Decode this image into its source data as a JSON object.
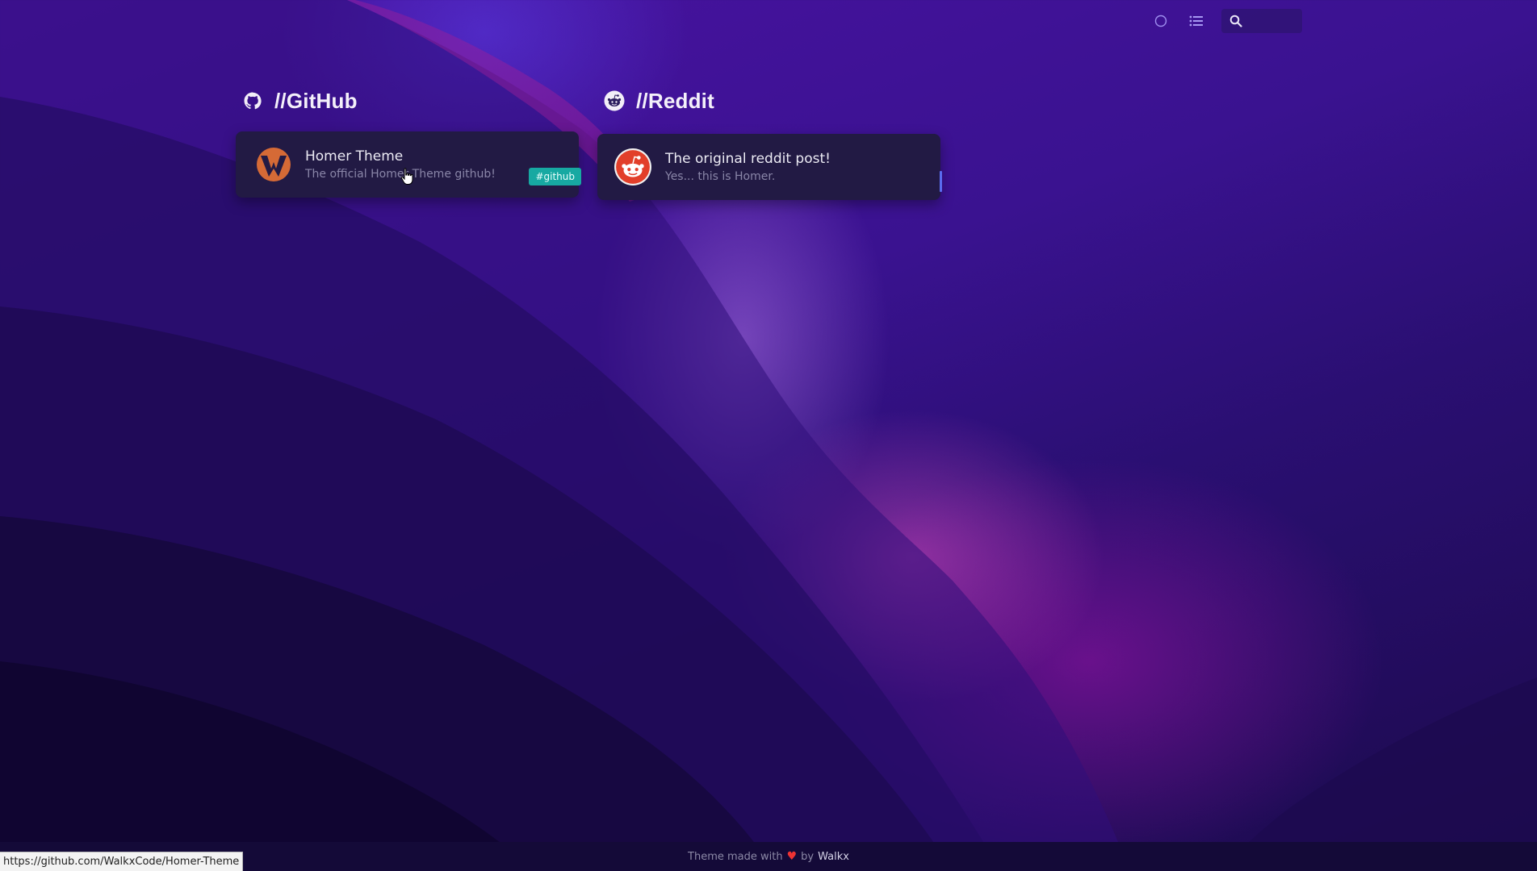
{
  "navbar": {
    "search_placeholder": "",
    "icons": [
      "circle-icon",
      "list-icon",
      "search-icon"
    ]
  },
  "groups": [
    {
      "title": "//GitHub",
      "icon": "github-icon",
      "items": [
        {
          "title": "Homer Theme",
          "subtitle": "The official Homer Theme github!",
          "tag": "#github",
          "logo": "walkx-logo"
        }
      ]
    },
    {
      "title": "//Reddit",
      "icon": "reddit-icon",
      "items": [
        {
          "title": "The original reddit post!",
          "subtitle": "Yes... this is Homer.",
          "logo": "reddit-logo"
        }
      ]
    }
  ],
  "footer": {
    "prefix": "Theme made with",
    "by": "by",
    "author": "Walkx"
  },
  "status_url": "https://github.com/WalkxCode/Homer-Theme",
  "colors": {
    "card": "#221a44",
    "tag": "#17a9a2",
    "accent": "#5a6cf0",
    "footer": "#140a38"
  }
}
